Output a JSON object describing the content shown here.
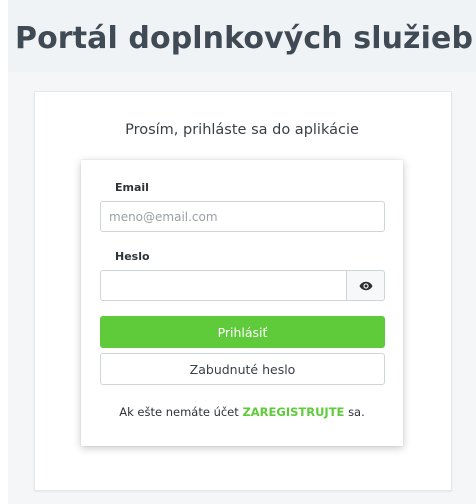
{
  "header": {
    "title": "Portál doplnkových služieb"
  },
  "login": {
    "heading": "Prosím, prihláste sa do aplikácie",
    "email_label": "Email",
    "email_placeholder": "meno@email.com",
    "email_value": "",
    "password_label": "Heslo",
    "password_value": "",
    "show_password_icon": "eye-icon",
    "submit_label": "Prihlásiť",
    "forgot_label": "Zabudnuté heslo",
    "register_prefix": "Ak ešte nemáte účet",
    "register_link": "ZAREGISTRUJTE",
    "register_suffix": "sa."
  },
  "colors": {
    "accent": "#5fcb3a",
    "title": "#3f4a55",
    "background": "#f4f6f8"
  }
}
